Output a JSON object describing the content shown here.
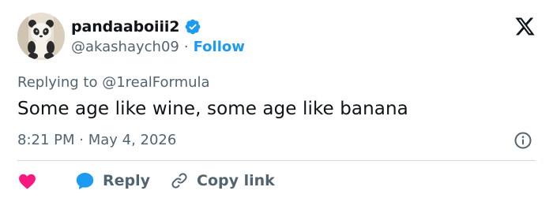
{
  "author": {
    "display_name": "pandaaboiii2",
    "handle": "@akashaych09",
    "separator": "·",
    "follow_label": "Follow",
    "verified_color": "#1d9bf0",
    "avatar_icon": "panda-avatar"
  },
  "tweet": {
    "reply_prefix": "Replying to ",
    "reply_to": "@1realFormula",
    "text": "Some age like wine, some age like banana",
    "timestamp": "8:21 PM · May 4, 2026"
  },
  "actions": {
    "like_icon": "heart-icon",
    "like_color": "#f91880",
    "reply_label": "Reply",
    "reply_color": "#1d9bf0",
    "copy_label": "Copy link"
  },
  "colors": {
    "text": "#0f1419",
    "secondary": "#536471",
    "accent": "#1d9bf0",
    "divider": "#cfd9de"
  }
}
